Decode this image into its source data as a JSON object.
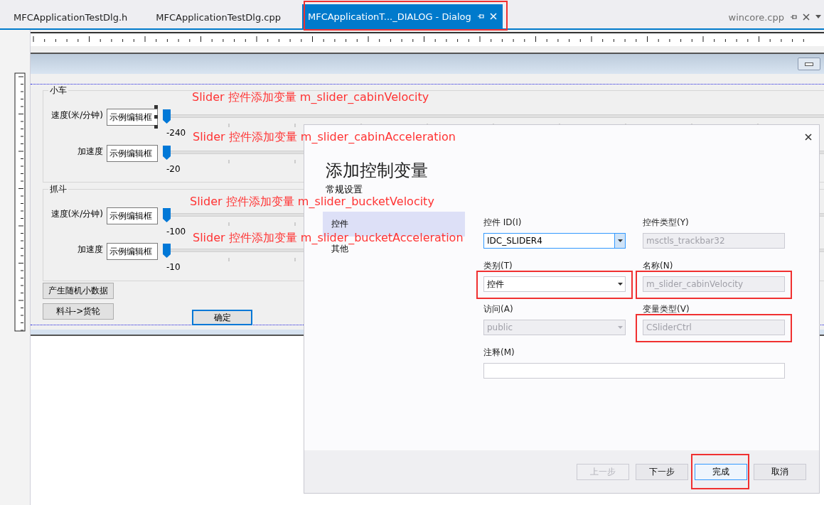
{
  "tabs": [
    {
      "label": "MFCApplicationTestDlg.h",
      "kind": "document",
      "selected": false,
      "highlighted": false
    },
    {
      "label": "MFCApplicationTestDlg.cpp",
      "kind": "document",
      "selected": false,
      "highlighted": false
    },
    {
      "label": "MFCApplicationT..._DIALOG - Dialog",
      "kind": "document",
      "selected": true,
      "highlighted": true
    },
    {
      "label": "wincore.cpp",
      "kind": "preview",
      "selected": false,
      "highlighted": false
    }
  ],
  "designer": {
    "groups": [
      {
        "title": "小车",
        "rows": [
          {
            "label": "速度(米/分钟)",
            "edit": "示例编辑框",
            "selected": true,
            "level": 0,
            "value": "-240"
          },
          {
            "label": "加速度",
            "edit": "示例编辑框",
            "selected": false,
            "level": 0,
            "value": "-20"
          }
        ]
      },
      {
        "title": "抓斗",
        "rows": [
          {
            "label": "速度(米/分钟)",
            "edit": "示例编辑框",
            "selected": false,
            "level": 0,
            "value": "-100"
          },
          {
            "label": "加速度",
            "edit": "示例编辑框",
            "selected": false,
            "level": 0,
            "value": "-10"
          }
        ]
      }
    ],
    "buttons": [
      "产生随机小数据",
      "料斗->货轮"
    ],
    "ok_button": "确定"
  },
  "annotations": [
    "Slider 控件添加变量  m_slider_cabinVelocity",
    "Slider 控件添加变量  m_slider_cabinAcceleration",
    "Slider 控件添加变量  m_slider_bucketVelocity",
    "Slider 控件添加变量  m_slider_bucketAcceleration"
  ],
  "wizard": {
    "title": "添加控制变量",
    "subtitle": "常规设置",
    "nav": [
      {
        "label": "控件",
        "selected": true
      },
      {
        "label": "其他",
        "selected": false
      }
    ],
    "fields": [
      {
        "label": "控件 ID(I)",
        "kind": "combo",
        "value": "IDC_SLIDER4",
        "disabled": false,
        "highlighted": false
      },
      {
        "label": "控件类型(Y)",
        "kind": "text",
        "value": "msctls_trackbar32",
        "disabled": true,
        "highlighted": false
      },
      {
        "label": "类别(T)",
        "kind": "combo",
        "value": "控件",
        "disabled": false,
        "highlighted": true
      },
      {
        "label": "名称(N)",
        "kind": "text",
        "value": "m_slider_cabinVelocity",
        "disabled": true,
        "highlighted": true
      },
      {
        "label": "访问(A)",
        "kind": "combo",
        "value": "public",
        "disabled": true,
        "highlighted": false
      },
      {
        "label": "变量类型(V)",
        "kind": "text",
        "value": "CSliderCtrl",
        "disabled": true,
        "highlighted": true
      },
      {
        "label": "注释(M)",
        "kind": "wide",
        "disabled": false,
        "highlighted": false
      }
    ],
    "buttons": [
      {
        "label": "上一步",
        "disabled": true,
        "highlighted": false
      },
      {
        "label": "下一步",
        "disabled": false,
        "highlighted": false
      },
      {
        "label": "完成",
        "disabled": false,
        "highlighted": true
      },
      {
        "label": "取消",
        "disabled": false,
        "highlighted": false
      }
    ]
  }
}
